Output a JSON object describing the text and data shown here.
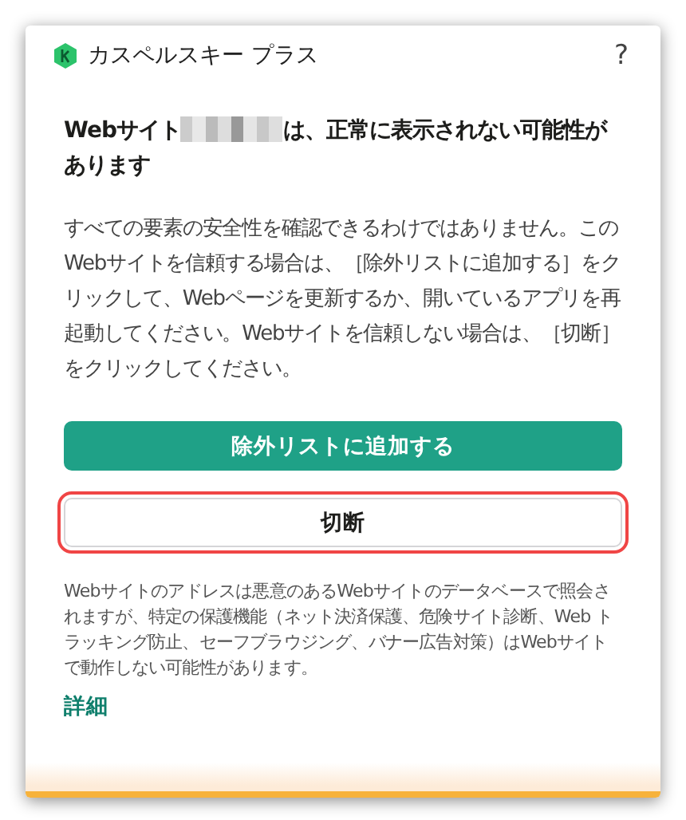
{
  "window": {
    "title": "カスペルスキー プラス",
    "help": "?"
  },
  "heading": {
    "before": "Webサイト",
    "after": "は、正常に表示されない可能性があります",
    "redacted": true
  },
  "body": "すべての要素の安全性を確認できるわけではありません。このWebサイトを信頼する場合は、［除外リストに追加する］をクリックして、Webページを更新するか、開いているアプリを再起動してください。Webサイトを信頼しない場合は、［切断］をクリックしてください。",
  "buttons": [
    {
      "kind": "primary",
      "label": "除外リストに追加する",
      "highlighted": false
    },
    {
      "kind": "secondary",
      "label": "切断",
      "highlighted": true
    }
  ],
  "note": "Webサイトのアドレスは悪意のあるWebサイトのデータベースで照会されますが、特定の保護機能（ネット決済保護、危険サイト診断、Web トラッキング防止、セーフブラウジング、バナー広告対策）はWebサイトで動作しない可能性があります。",
  "details_link": "詳細"
}
